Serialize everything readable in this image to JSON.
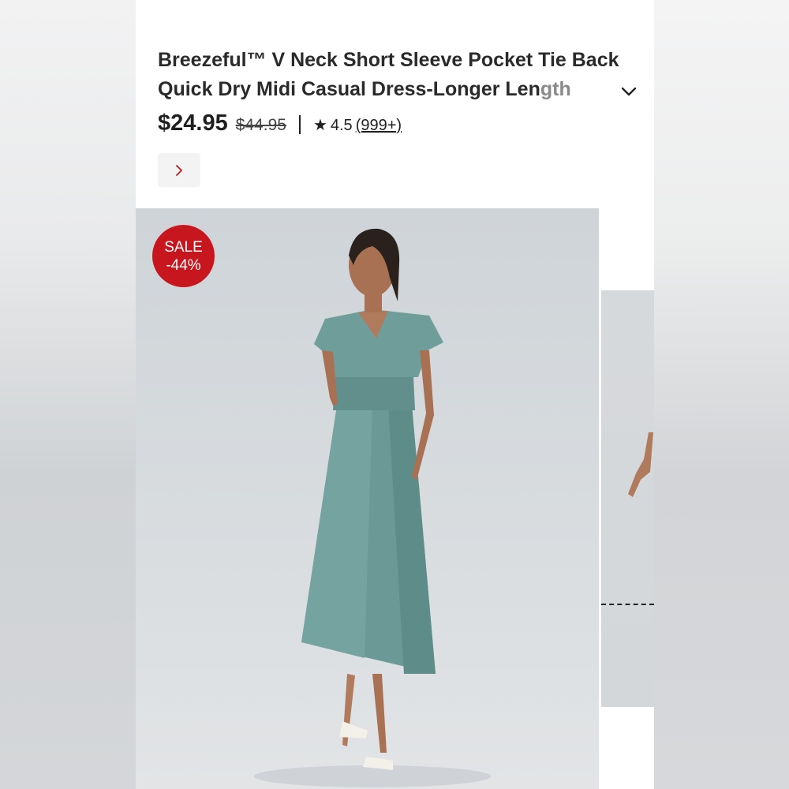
{
  "product": {
    "title_main": "Breezeful™ V Neck Short Sleeve Pocket Tie Back Quick Dry Midi Casual Dress-Longer Len",
    "title_fade": "gth",
    "price": "$24.95",
    "original_price": "$44.95",
    "rating": "4.5",
    "review_count": "(999+)"
  },
  "badge": {
    "line1": "SALE",
    "line2": "-44%"
  },
  "icons": {
    "expand": "chevron-down-icon",
    "next": "chevron-right-icon",
    "rating": "star-icon"
  },
  "colors": {
    "sale_red": "#c8161e",
    "dress_teal": "#6b9a96",
    "text_dark": "#2a2a2a"
  }
}
